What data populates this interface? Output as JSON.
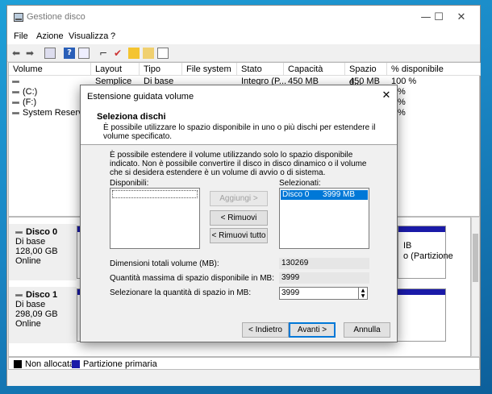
{
  "window": {
    "title": "Gestione disco",
    "min": "—",
    "max": "☐",
    "close": "✕"
  },
  "menu": [
    "File",
    "Azione",
    "Visualizza",
    "?"
  ],
  "toolbar_icons": [
    "back-arrow-icon",
    "forward-arrow-icon",
    "console-icon",
    "help-icon",
    "properties-icon",
    "connect-icon",
    "checklist-icon",
    "folder-icon",
    "list-view-icon"
  ],
  "volume_table": {
    "columns": [
      "Volume",
      "Layout",
      "Tipo",
      "File system",
      "Stato",
      "Capacità",
      "Spazio d...",
      "% disponibile"
    ],
    "rows": [
      [
        "",
        "Semplice",
        "Di base",
        "",
        "Integro (P...",
        "450 MB",
        "450 MB",
        "100 %"
      ],
      [
        "(C:)",
        "",
        "",
        "",
        "",
        "",
        "",
        "%"
      ],
      [
        "(F:)",
        "",
        "",
        "",
        "",
        "",
        "",
        "%"
      ],
      [
        "System Reserved",
        "",
        "",
        "",
        "",
        "",
        "",
        "%"
      ]
    ]
  },
  "disks": [
    {
      "name": "Disco 0",
      "type": "Di base",
      "size": "128,00 GB",
      "status": "Online",
      "partition_fragments": [
        "S",
        "3",
        "I"
      ],
      "right_fragments": [
        "IB",
        "o (Partizione"
      ]
    },
    {
      "name": "Disco 1",
      "type": "Di base",
      "size": "298,09 GB",
      "status": "Online",
      "partition_fragments": [
        "2",
        "I"
      ]
    }
  ],
  "legend": [
    {
      "label": "Non allocata",
      "color": "#000000"
    },
    {
      "label": "Partizione primaria",
      "color": "#1a1aa8"
    }
  ],
  "wizard": {
    "title": "Estensione guidata volume",
    "close": "✕",
    "heading": "Seleziona dischi",
    "subtext": "È possibile utilizzare lo spazio disponibile in uno o più dischi per estendere il volume specificato.",
    "description": "È possibile estendere il volume utilizzando solo lo spazio disponibile indicato. Non è possibile convertire il disco in disco dinamico o il volume che si desidera estendere è un volume di avvio o di sistema.",
    "available_label": "Disponibili:",
    "selected_label": "Selezionati:",
    "selected_items": [
      "Disco 0      3999 MB"
    ],
    "buttons": {
      "add": "Aggiungi >",
      "remove": "< Rimuovi",
      "remove_all": "< Rimuovi tutto"
    },
    "fields": [
      {
        "label": "Dimensioni totali volume (MB):",
        "value": "130269"
      },
      {
        "label": "Quantità massima di spazio disponibile in MB:",
        "value": "3999"
      },
      {
        "label": "Selezionare la quantità di spazio in MB:",
        "value": "3999"
      }
    ],
    "nav": {
      "back": "< Indietro",
      "next": "Avanti >",
      "cancel": "Annulla"
    },
    "spin_up": "▲",
    "spin_down": "▼"
  }
}
